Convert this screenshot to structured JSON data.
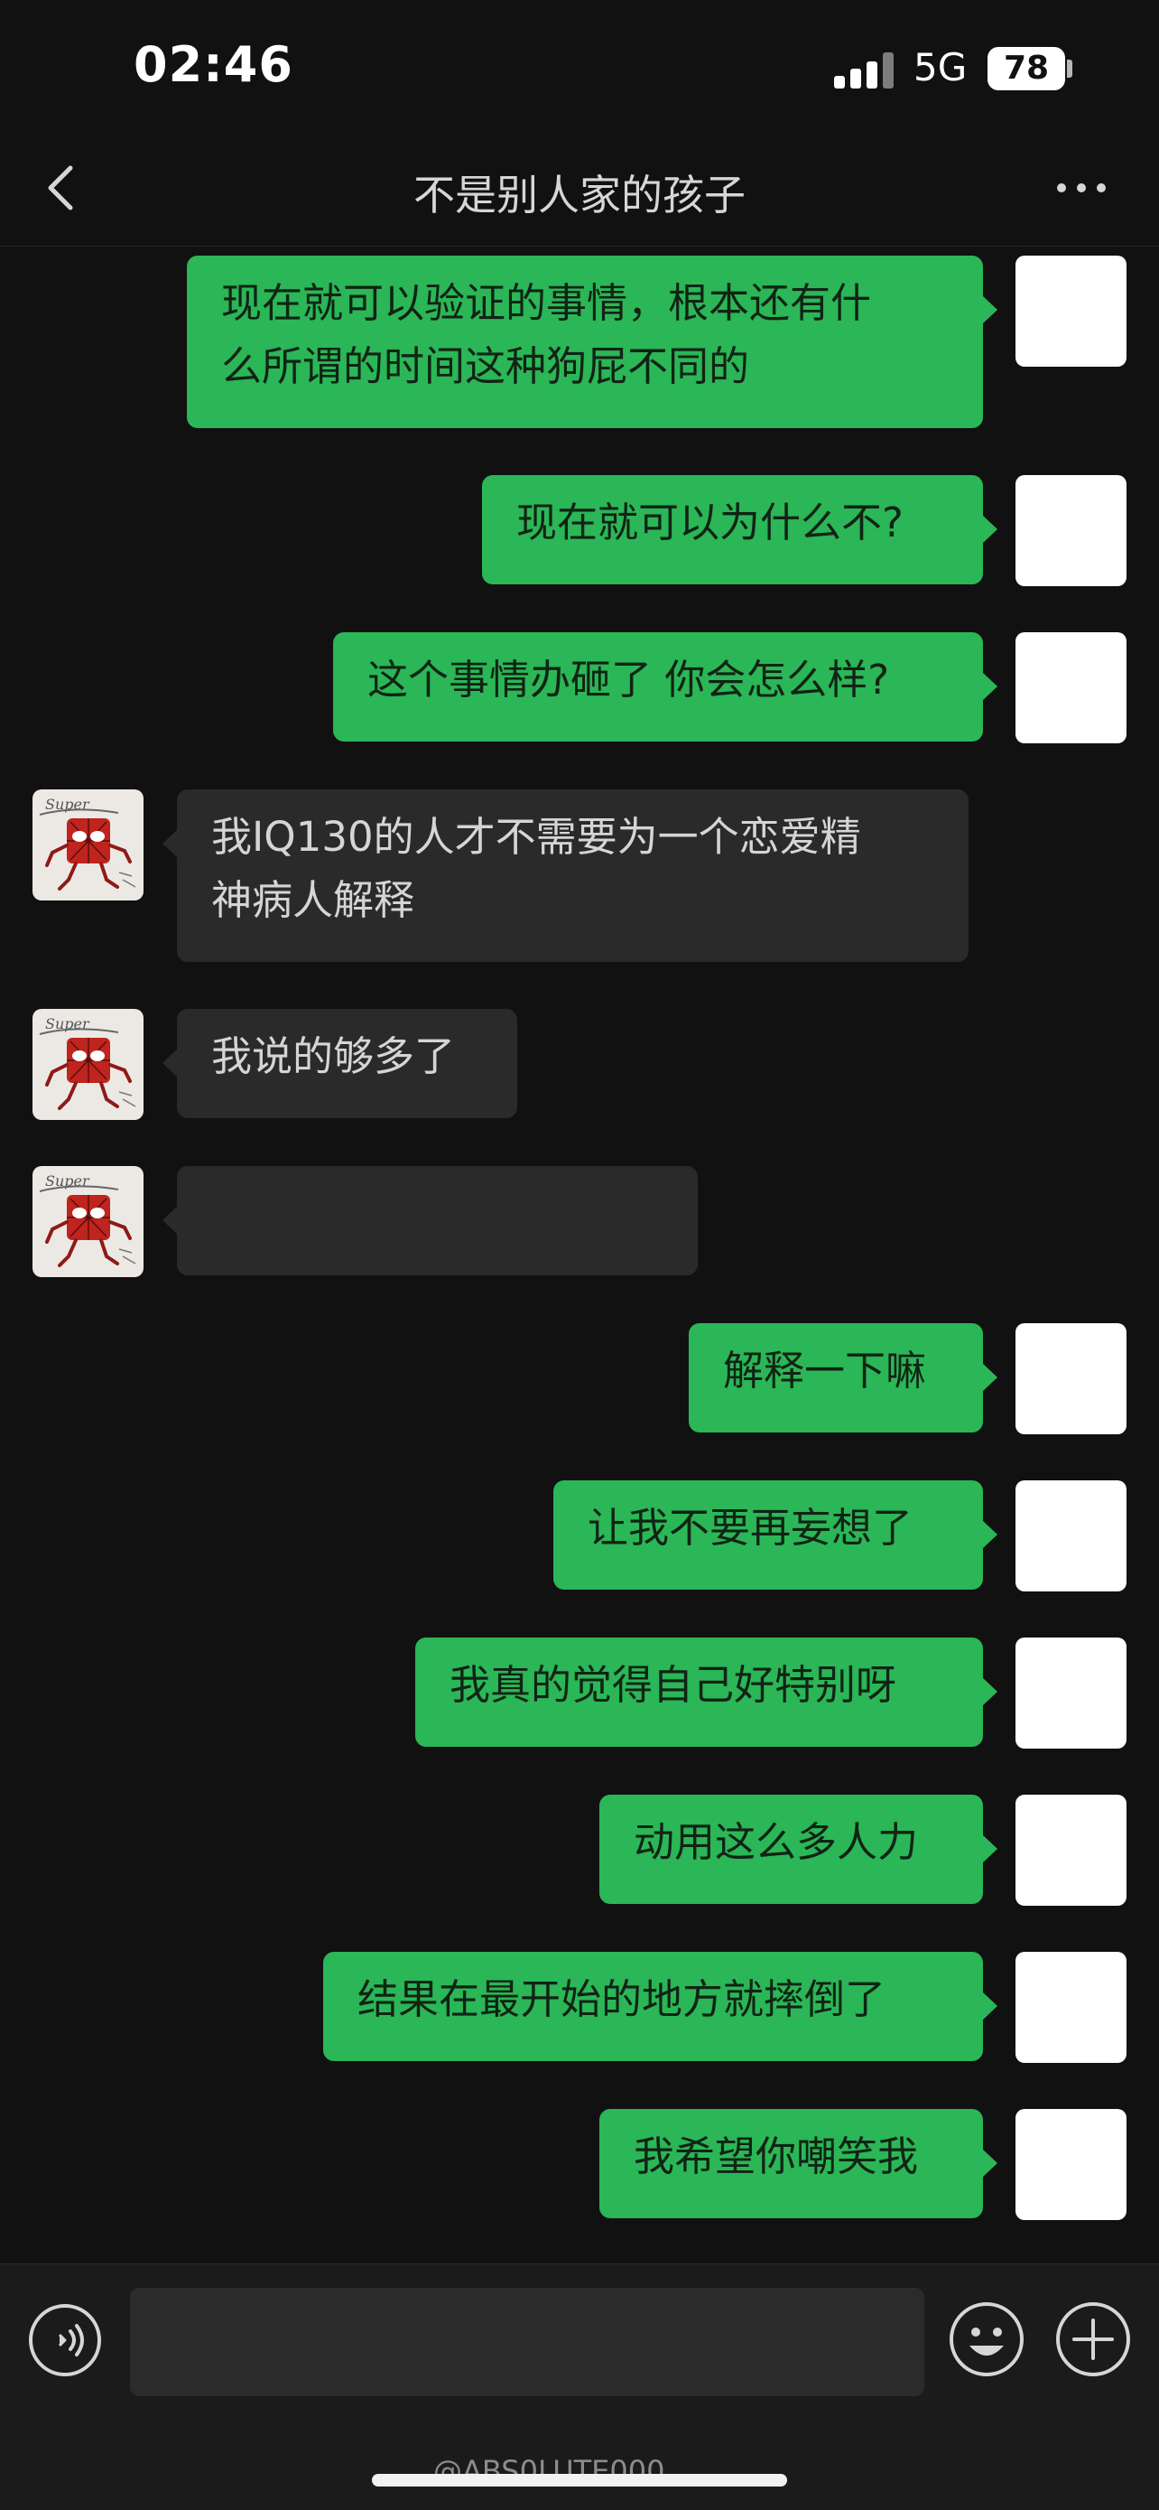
{
  "status_bar": {
    "time": "02:46",
    "network": "5G",
    "battery": "78"
  },
  "nav": {
    "title": "不是别人家的孩子"
  },
  "messages": [
    {
      "side": "out",
      "lines": [
        "现在就可以验证的事情，根本还有什",
        "么所谓的时间这种狗屁不同的"
      ]
    },
    {
      "side": "out",
      "lines": [
        "现在就可以为什么不?"
      ]
    },
    {
      "side": "out",
      "lines": [
        "这个事情办砸了 你会怎么样?"
      ]
    },
    {
      "side": "in",
      "lines": [
        "我IQ130的人才不需要为一个恋爱精",
        "神病人解释"
      ]
    },
    {
      "side": "in",
      "lines": [
        "我说的够多了"
      ]
    },
    {
      "side": "in",
      "lines": [
        ""
      ],
      "note_blank": true
    },
    {
      "side": "out",
      "lines": [
        "解释一下嘛"
      ]
    },
    {
      "side": "out",
      "lines": [
        "让我不要再妄想了"
      ]
    },
    {
      "side": "out",
      "lines": [
        "我真的觉得自己好特别呀"
      ]
    },
    {
      "side": "out",
      "lines": [
        "动用这么多人力"
      ]
    },
    {
      "side": "out",
      "lines": [
        "结果在最开始的地方就摔倒了"
      ]
    },
    {
      "side": "out",
      "lines": [
        "我希望你嘲笑我"
      ]
    }
  ],
  "avatar_text": "Super",
  "input": {
    "value": ""
  },
  "watermark": "@ABS0LUTE000",
  "colors": {
    "sent_bubble": "#2bb657",
    "received_bubble": "#2a2a2a",
    "background": "#111111"
  }
}
